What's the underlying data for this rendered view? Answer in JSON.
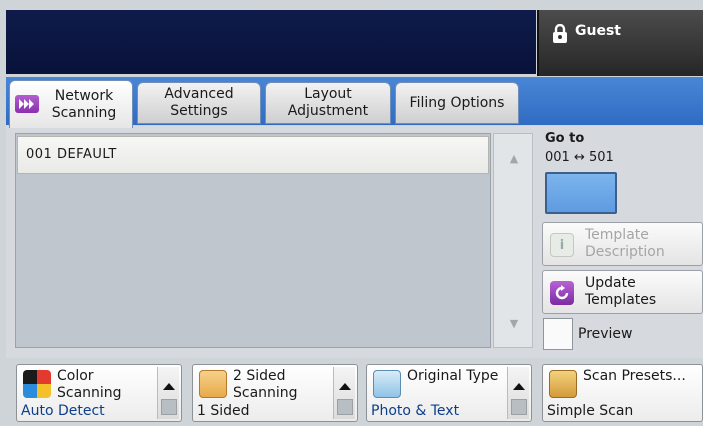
{
  "header": {
    "user_name": "Guest"
  },
  "tabs": [
    {
      "label": "Network\nScanning"
    },
    {
      "label": "Advanced\nSettings"
    },
    {
      "label": "Layout\nAdjustment"
    },
    {
      "label": "Filing Options"
    }
  ],
  "template_list": {
    "items": [
      {
        "label": "001  DEFAULT"
      }
    ]
  },
  "goto": {
    "label": "Go to",
    "range": "001 ↔ 501",
    "value": ""
  },
  "side_buttons": {
    "template_description": "Template\nDescription",
    "update_templates": "Update\nTemplates",
    "preview": "Preview"
  },
  "features": [
    {
      "title": "Color\nScanning",
      "value": "Auto Detect"
    },
    {
      "title": "2 Sided\nScanning",
      "value": "1 Sided"
    },
    {
      "title": "Original Type",
      "value": "Photo & Text"
    },
    {
      "title": "Scan Presets...",
      "value": "Simple Scan"
    }
  ],
  "colors": {
    "header_bg": "#0f1b4a",
    "tab_strip": "#3a77cc",
    "goto_field": "#6ea8e8",
    "accent_purple": "#9a44c2"
  }
}
